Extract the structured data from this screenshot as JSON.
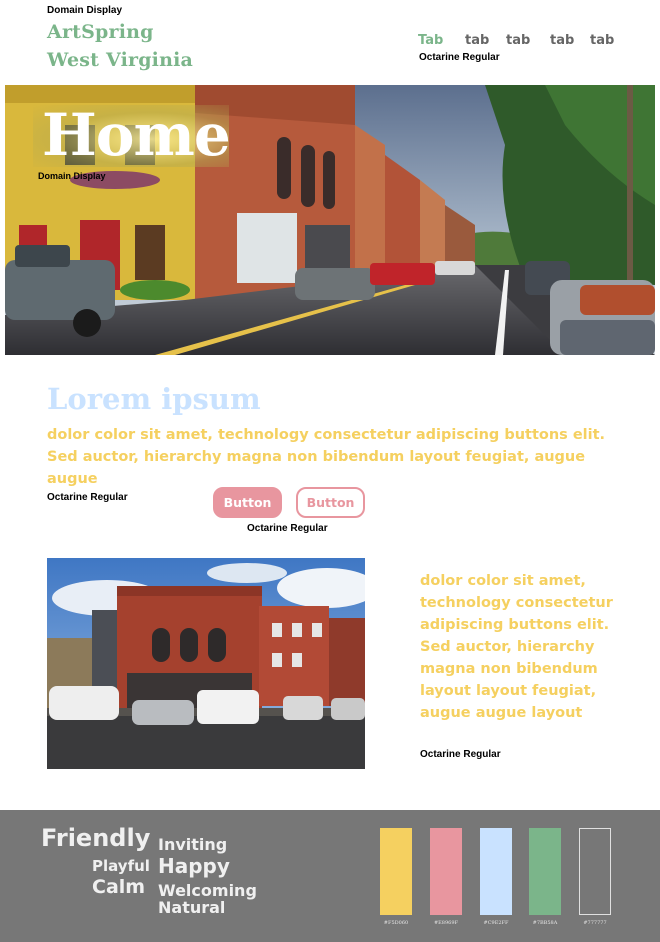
{
  "header": {
    "annotation_top": "Domain Display",
    "brand_line1": "ArtSpring",
    "brand_line2": "West Virginia",
    "tabs": [
      "Tab",
      "tab",
      "tab",
      "tab",
      "tab"
    ],
    "tabs_annotation": "Octarine Regular"
  },
  "hero": {
    "title": "Home",
    "annotation": "Domain Display"
  },
  "intro": {
    "title": "Lorem ipsum",
    "body": "dolor color sit amet, technology consectetur adipiscing buttons elit. Sed auctor, hierarchy magna non bibendum layout feugiat, augue augue",
    "annotation": "Octarine Regular"
  },
  "buttons": {
    "primary_label": "Button",
    "secondary_label": "Button",
    "annotation": "Octarine Regular"
  },
  "feature": {
    "body": "dolor color sit amet, technology consectetur adipiscing buttons elit. Sed auctor, hierarchy magna non bibendum layout layout feugiat, augue augue  layout",
    "annotation": "Octarine Regular"
  },
  "footer": {
    "words": {
      "friendly": "Friendly",
      "inviting": "Inviting",
      "playful": "Playful",
      "happy": "Happy",
      "calm": "Calm",
      "welcoming": "Welcoming",
      "natural": "Natural"
    },
    "swatches": [
      {
        "color": "#F5D060",
        "label": "#F5D060"
      },
      {
        "color": "#E8969F",
        "label": "#E8969F"
      },
      {
        "color": "#C9E2FF",
        "label": "#C9E2FF"
      },
      {
        "color": "#7BB58A",
        "label": "#7BB58A"
      },
      {
        "color": "#777777",
        "label": "#777777"
      }
    ]
  },
  "colors": {
    "accent_green": "#7BB58A",
    "accent_yellow": "#F5D060",
    "accent_pink": "#E8969F",
    "accent_blue": "#C9E2FF",
    "footer_gray": "#777777"
  }
}
